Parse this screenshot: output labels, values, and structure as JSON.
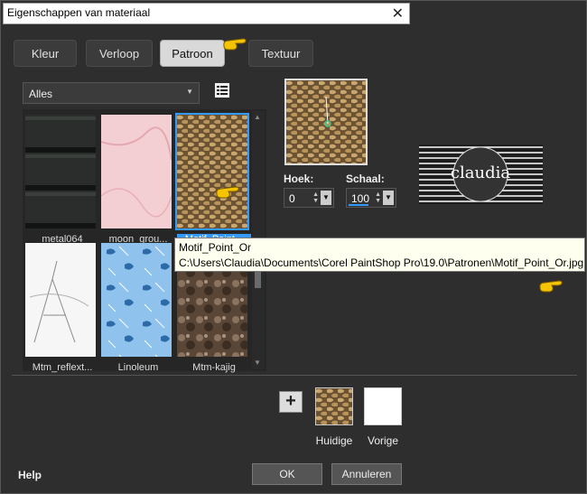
{
  "window": {
    "title": "Eigenschappen van materiaal",
    "close_glyph": "✕"
  },
  "tabs": [
    {
      "label": "Kleur",
      "active": false
    },
    {
      "label": "Verloop",
      "active": false
    },
    {
      "label": "Patroon",
      "active": true
    },
    {
      "label": "Textuur",
      "active": false
    }
  ],
  "filter": {
    "selected": "Alles"
  },
  "patterns": [
    {
      "name": "metal064"
    },
    {
      "name": "moon_grou..."
    },
    {
      "name": "Motif_Point...",
      "selected": true
    },
    {
      "name": "Mtm_reflext..."
    },
    {
      "name": "Linoleum"
    },
    {
      "name": "Mtm-kajig"
    }
  ],
  "angle": {
    "label": "Hoek:",
    "value": "0"
  },
  "scale": {
    "label": "Schaal:",
    "value": "100"
  },
  "tooltip": {
    "name": "Motif_Point_Or",
    "path": "C:\\Users\\Claudia\\Documents\\Corel PaintShop Pro\\19.0\\Patronen\\Motif_Point_Or.jpg"
  },
  "logo": {
    "text": "claudia"
  },
  "swatches": {
    "add_glyph": "+",
    "current_label": "Huidige",
    "previous_label": "Vorige"
  },
  "footer": {
    "help": "Help",
    "ok": "OK",
    "cancel": "Annuleren"
  },
  "colors": {
    "accent": "#3399ff",
    "dialog_bg": "#2e2e2e",
    "finger": "#f5c400"
  }
}
